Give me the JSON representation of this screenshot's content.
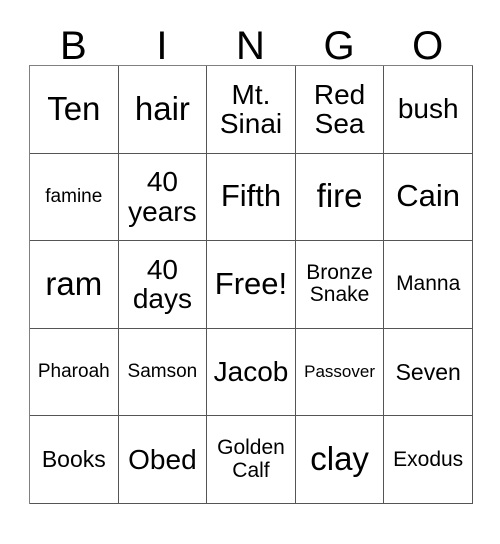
{
  "card": {
    "title": "BINGO",
    "columns": [
      {
        "letter": "B"
      },
      {
        "letter": "I"
      },
      {
        "letter": "N"
      },
      {
        "letter": "G"
      },
      {
        "letter": "O"
      }
    ],
    "rows": [
      [
        {
          "text": "Ten",
          "size": "sz-xl"
        },
        {
          "text": "hair",
          "size": "sz-xl"
        },
        {
          "text": "Mt. Sinai",
          "size": "sz-md"
        },
        {
          "text": "Red Sea",
          "size": "sz-md"
        },
        {
          "text": "bush",
          "size": "sz-md"
        }
      ],
      [
        {
          "text": "famine",
          "size": "sz-xxs"
        },
        {
          "text": "40 years",
          "size": "sz-md"
        },
        {
          "text": "Fifth",
          "size": "sz-lg"
        },
        {
          "text": "fire",
          "size": "sz-xl"
        },
        {
          "text": "Cain",
          "size": "sz-lg"
        }
      ],
      [
        {
          "text": "ram",
          "size": "sz-xl"
        },
        {
          "text": "40 days",
          "size": "sz-md"
        },
        {
          "text": "Free!",
          "size": "sz-lg"
        },
        {
          "text": "Bronze Snake",
          "size": "sz-xs"
        },
        {
          "text": "Manna",
          "size": "sz-xs"
        }
      ],
      [
        {
          "text": "Pharoah",
          "size": "sz-xxs"
        },
        {
          "text": "Samson",
          "size": "sz-xxs"
        },
        {
          "text": "Jacob",
          "size": "sz-md"
        },
        {
          "text": "Passover",
          "size": "sz-tiny"
        },
        {
          "text": "Seven",
          "size": "sz-sm"
        }
      ],
      [
        {
          "text": "Books",
          "size": "sz-sm"
        },
        {
          "text": "Obed",
          "size": "sz-md"
        },
        {
          "text": "Golden Calf",
          "size": "sz-xs"
        },
        {
          "text": "clay",
          "size": "sz-xl"
        },
        {
          "text": "Exodus",
          "size": "sz-xs"
        }
      ]
    ]
  }
}
